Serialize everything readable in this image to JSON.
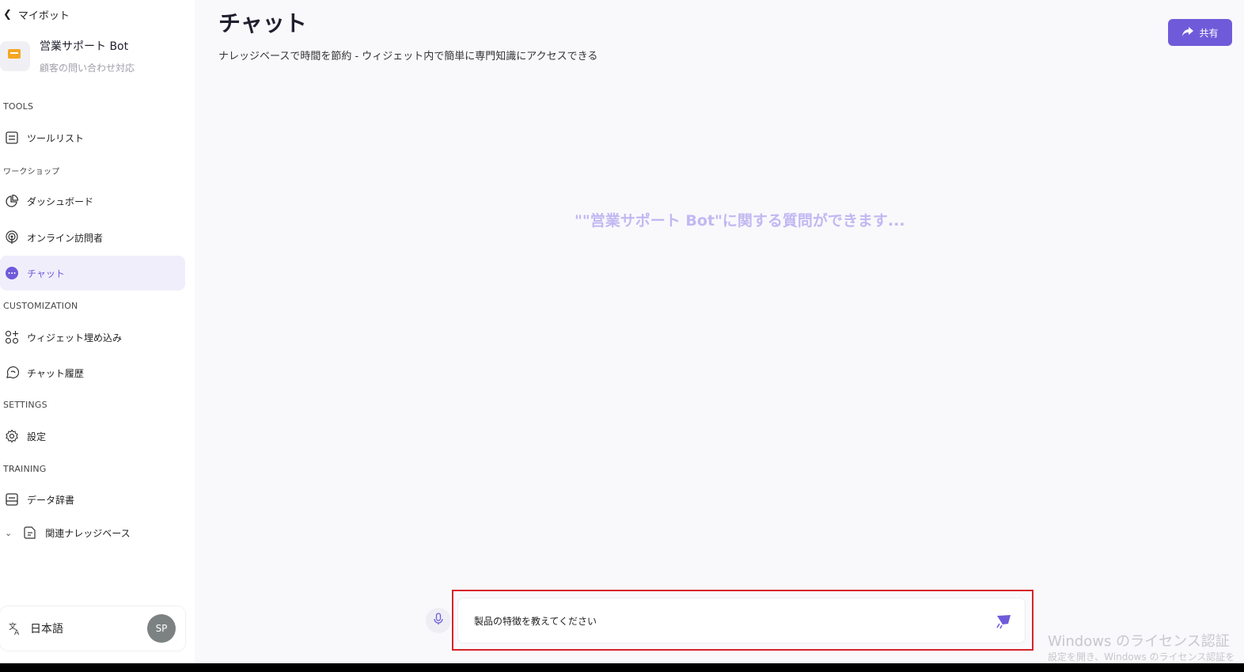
{
  "sidebar": {
    "back_label": "マイボット",
    "bot": {
      "name": "営業サポート Bot",
      "description": "顧客の問い合わせ対応"
    },
    "sections": {
      "tools": "TOOLS",
      "workshop": "ワークショップ",
      "customization": "CUSTOMIZATION",
      "settings": "SETTINGS",
      "training": "TRAINING"
    },
    "items": {
      "tool_list": "ツールリスト",
      "dashboard": "ダッシュボード",
      "online_visitors": "オンライン訪問者",
      "chat": "チャット",
      "widget_embed": "ウィジェット埋め込み",
      "chat_history": "チャット履歴",
      "settings": "設定",
      "data_dictionary": "データ辞書",
      "related_kb": "関連ナレッジベース"
    },
    "language": "日本語",
    "user_initials": "SP"
  },
  "main": {
    "title": "チャット",
    "subtitle": "ナレッジベースで時間を節約 - ウィジェット内で簡単に専門知識にアクセスできる",
    "share_label": "共有",
    "placeholder": "\"\"営業サポート Bot\"に関する質問ができます...",
    "input_value": "製品の特徴を教えてください"
  },
  "watermark": {
    "title": "Windows のライセンス認証",
    "subtitle": "設定を開き、Windows のライセンス認証を"
  },
  "colors": {
    "accent": "#6f5bd9",
    "active_bg": "#f1eefc",
    "highlight_border": "#d8232a",
    "placeholder": "#c2b8f2"
  }
}
